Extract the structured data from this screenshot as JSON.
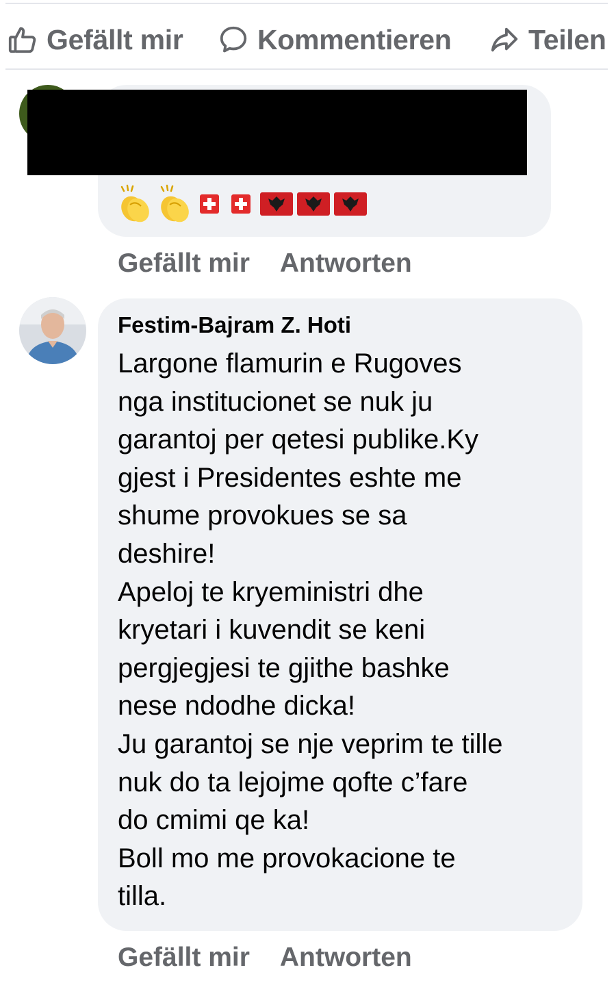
{
  "action_bar": {
    "like_label": "Gefällt mir",
    "comment_label": "Kommentieren",
    "share_label": "Teilen"
  },
  "comment_1": {
    "author_redacted": true,
    "emoji_text": [
      "clapping-hands",
      "clapping-hands",
      "flag-switzerland",
      "flag-switzerland",
      "flag-albania",
      "flag-albania",
      "flag-albania"
    ],
    "actions": {
      "like_label": "Gefällt mir",
      "reply_label": "Antworten"
    }
  },
  "comment_2": {
    "author": "Festim-Bajram Z. Hoti",
    "text_lines": [
      "Largone flamurin e Rugoves",
      "nga institucionet se nuk ju",
      "garantoj per qetesi publike.Ky",
      "gjest i Presidentes eshte me",
      "shume provokues se sa",
      "deshire!",
      "Apeloj te kryeministri dhe",
      "kryetari i kuvendit se keni",
      "pergjegjesi te gjithe bashke",
      "nese ndodhe dicka!",
      "Ju garantoj se nje veprim te tille",
      "nuk do ta lejojme qofte c’fare",
      "do cmimi qe ka!",
      "Boll mo me provokacione te",
      "tilla."
    ],
    "actions": {
      "like_label": "Gefällt mir",
      "reply_label": "Antworten"
    }
  },
  "colors": {
    "secondary_text": "#65676b",
    "bubble_bg": "#f0f2f5",
    "divider": "#e4e6eb",
    "primary_text": "#050505"
  }
}
